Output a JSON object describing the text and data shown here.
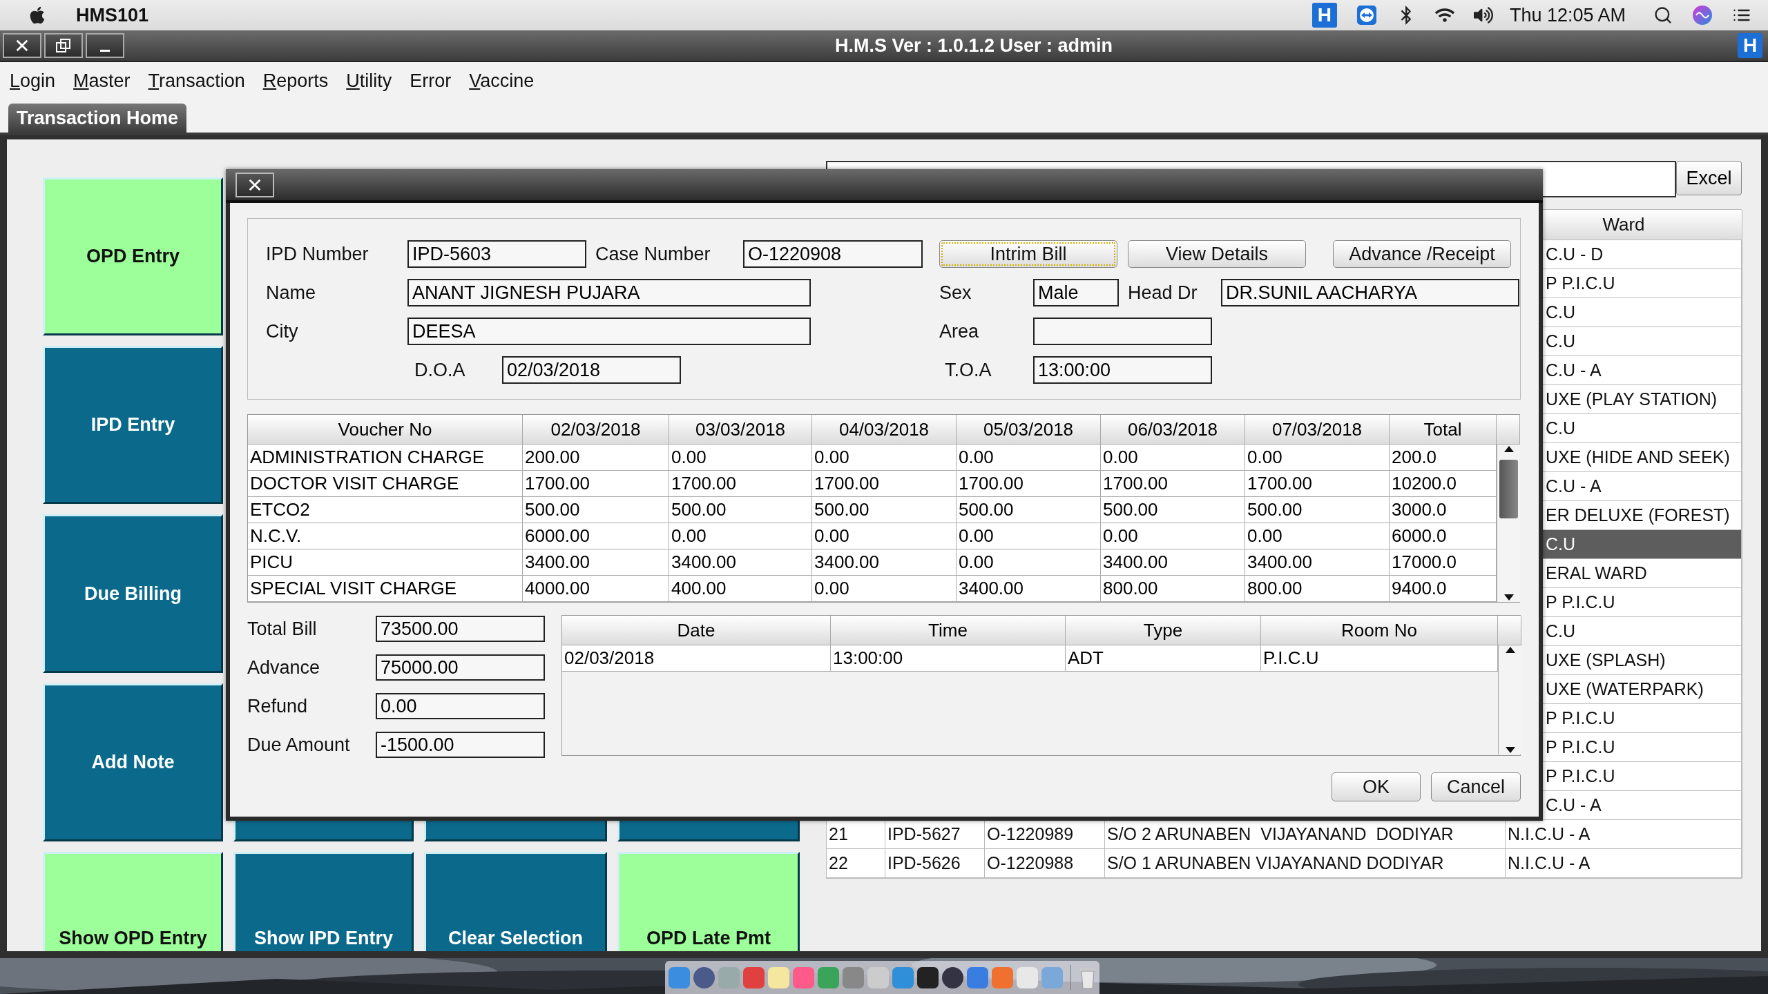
{
  "menubar": {
    "app_name": "HMS101",
    "status_icons": [
      {
        "label": "H"
      }
    ],
    "clock": "Thu 12:05 AM"
  },
  "window": {
    "title": "H.M.S Ver : 1.0.1.2 User : admin",
    "badge": "H"
  },
  "menu": [
    {
      "label": "Login",
      "mnemonic": true
    },
    {
      "label": "Master",
      "mnemonic": true
    },
    {
      "label": "Transaction",
      "mnemonic": true
    },
    {
      "label": "Reports",
      "mnemonic": true
    },
    {
      "label": "Utility",
      "mnemonic": true
    },
    {
      "label": "Error",
      "mnemonic": false
    },
    {
      "label": "Vaccine",
      "mnemonic": true
    }
  ],
  "tabs": [
    {
      "label": "Transaction Home",
      "selected": true
    }
  ],
  "side_buttons": [
    {
      "label": "OPD Entry",
      "color": "#9cff99"
    },
    {
      "label": "IPD Entry",
      "color": "#0b6a8c"
    },
    {
      "label": "Due Billing",
      "color": "#0b6a8c"
    },
    {
      "label": "Add Note",
      "color": "#0b6a8c"
    }
  ],
  "partial_tiles": [
    {
      "color": "#0b6a8c"
    },
    {
      "color": "#0b6a8c"
    },
    {
      "color": "#0b6a8c"
    }
  ],
  "bottom_buttons": [
    {
      "label": "Show OPD Entry",
      "color": "#9cff99"
    },
    {
      "label": "Show IPD Entry",
      "color": "#0b6a8c"
    },
    {
      "label": "Clear Selection",
      "color": "#0b6a8c"
    },
    {
      "label": "OPD Late Pmt",
      "color": "#9cff99"
    }
  ],
  "records": {
    "export_button": "Excel",
    "ward_header": "Ward",
    "rows": [
      {
        "ward": "C.U - D",
        "selected": false
      },
      {
        "ward": "P P.I.C.U",
        "selected": false
      },
      {
        "ward": "C.U",
        "selected": false
      },
      {
        "ward": "C.U",
        "selected": false
      },
      {
        "ward": "C.U - A",
        "selected": false
      },
      {
        "ward": "UXE (PLAY STATION)",
        "selected": false
      },
      {
        "ward": "C.U",
        "selected": false
      },
      {
        "ward": "UXE (HIDE AND SEEK)",
        "selected": false
      },
      {
        "ward": "C.U - A",
        "selected": false
      },
      {
        "ward": "ER DELUXE (FOREST)",
        "selected": false
      },
      {
        "ward": "C.U",
        "selected": true
      },
      {
        "ward": "ERAL WARD",
        "selected": false
      },
      {
        "ward": "P P.I.C.U",
        "selected": false
      },
      {
        "ward": "C.U",
        "selected": false
      },
      {
        "ward": "UXE (SPLASH)",
        "selected": false
      },
      {
        "ward": "UXE (WATERPARK)",
        "selected": false
      },
      {
        "ward": "P P.I.C.U",
        "selected": false
      },
      {
        "ward": "P P.I.C.U",
        "selected": false
      },
      {
        "ward": "P P.I.C.U",
        "selected": false
      },
      {
        "ward": "C.U - A",
        "selected": false
      },
      {
        "no": "21",
        "ipd": "IPD-5627",
        "case": "O-1220989",
        "name": "S/O 2 ARUNABEN  VIJAYANAND  DODIYAR",
        "ward": "N.I.C.U - A",
        "selected": false
      },
      {
        "no": "22",
        "ipd": "IPD-5626",
        "case": "O-1220988",
        "name": "S/O 1 ARUNABEN VIJAYANAND DODIYAR",
        "ward": "N.I.C.U - A",
        "selected": false
      }
    ]
  },
  "dialog": {
    "fields": {
      "ipd_number": {
        "label": "IPD Number",
        "value": "IPD-5603"
      },
      "case_number": {
        "label": "Case Number",
        "value": "O-1220908"
      },
      "name": {
        "label": "Name",
        "value": "ANANT JIGNESH PUJARA"
      },
      "sex": {
        "label": "Sex",
        "value": "Male"
      },
      "head_dr": {
        "label": "Head Dr",
        "value": "DR.SUNIL AACHARYA"
      },
      "city": {
        "label": "City",
        "value": "DEESA"
      },
      "area": {
        "label": "Area"
      },
      "doa": {
        "label": "D.O.A",
        "value": "02/03/2018"
      },
      "toa": {
        "label": "T.O.A",
        "value": "13:00:00"
      }
    },
    "buttons": [
      {
        "label": "Intrim Bill",
        "focused": true
      },
      {
        "label": "View Details",
        "focused": false
      },
      {
        "label": "Advance /Receipt",
        "focused": false
      }
    ],
    "charges": {
      "columns": [
        "Voucher No",
        "02/03/2018",
        "03/03/2018",
        "04/03/2018",
        "05/03/2018",
        "06/03/2018",
        "07/03/2018",
        "Total"
      ],
      "rows": [
        [
          "ADMINISTRATION CHARGE",
          "200.00",
          "0.00",
          "0.00",
          "0.00",
          "0.00",
          "0.00",
          "200.0"
        ],
        [
          "DOCTOR VISIT CHARGE",
          "1700.00",
          "1700.00",
          "1700.00",
          "1700.00",
          "1700.00",
          "1700.00",
          "10200.0"
        ],
        [
          "ETCO2",
          "500.00",
          "500.00",
          "500.00",
          "500.00",
          "500.00",
          "500.00",
          "3000.0"
        ],
        [
          "N.C.V.",
          "6000.00",
          "0.00",
          "0.00",
          "0.00",
          "0.00",
          "0.00",
          "6000.0"
        ],
        [
          "PICU",
          "3400.00",
          "3400.00",
          "3400.00",
          "0.00",
          "3400.00",
          "3400.00",
          "17000.0"
        ],
        [
          "SPECIAL VISIT CHARGE",
          "4000.00",
          "400.00",
          "0.00",
          "3400.00",
          "800.00",
          "800.00",
          "9400.0"
        ]
      ]
    },
    "totals": [
      {
        "label": "Total Bill",
        "value": "73500.00"
      },
      {
        "label": "Advance",
        "value": "75000.00"
      },
      {
        "label": "Refund",
        "value": "0.00"
      },
      {
        "label": "Due Amount",
        "value": "-1500.00"
      }
    ],
    "admissions": {
      "columns": [
        "Date",
        "Time",
        "Type",
        "Room No"
      ],
      "rows": [
        [
          "02/03/2018",
          "13:00:00",
          "ADT",
          "P.I.C.U"
        ]
      ]
    },
    "footer_buttons": [
      "OK",
      "Cancel"
    ]
  }
}
